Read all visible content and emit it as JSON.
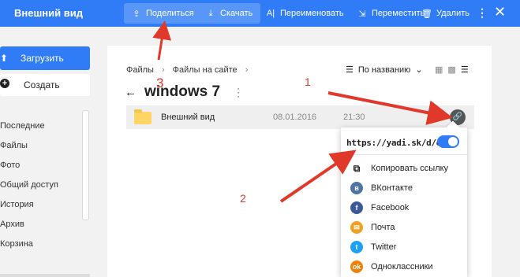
{
  "header": {
    "title": "Внешний вид",
    "buttons": {
      "share": "Поделиться",
      "download": "Скачать",
      "rename": "Переименовать",
      "move": "Переместить",
      "delete": "Удалить"
    },
    "more": "⋮",
    "close": "✕",
    "colors": {
      "bar": "#2f7cf6"
    }
  },
  "sidebar": {
    "upload": "Загрузить",
    "create": "Создать",
    "items": [
      "Последние",
      "Файлы",
      "Фото",
      "Общий доступ",
      "История",
      "Архив",
      "Корзина"
    ]
  },
  "main": {
    "breadcrumbs": [
      "Файлы",
      "Файлы на сайте"
    ],
    "sort_label": "По названию",
    "folder_title": "windows 7",
    "row": {
      "name": "Внешний вид",
      "date": "08.01.2016",
      "time": "21:30"
    }
  },
  "share_popup": {
    "url": "https://yadi.sk/d/eXH-",
    "toggle_on": true,
    "items": [
      {
        "label": "Копировать ссылку",
        "icon": "copy-icon"
      },
      {
        "label": "ВКонтакте",
        "icon": "vk-icon"
      },
      {
        "label": "Facebook",
        "icon": "facebook-icon"
      },
      {
        "label": "Почта",
        "icon": "mail-icon"
      },
      {
        "label": "Twitter",
        "icon": "twitter-icon"
      },
      {
        "label": "Одноклассники",
        "icon": "ok-icon"
      }
    ]
  },
  "annotations": {
    "one": "1",
    "two": "2",
    "three": "3"
  }
}
